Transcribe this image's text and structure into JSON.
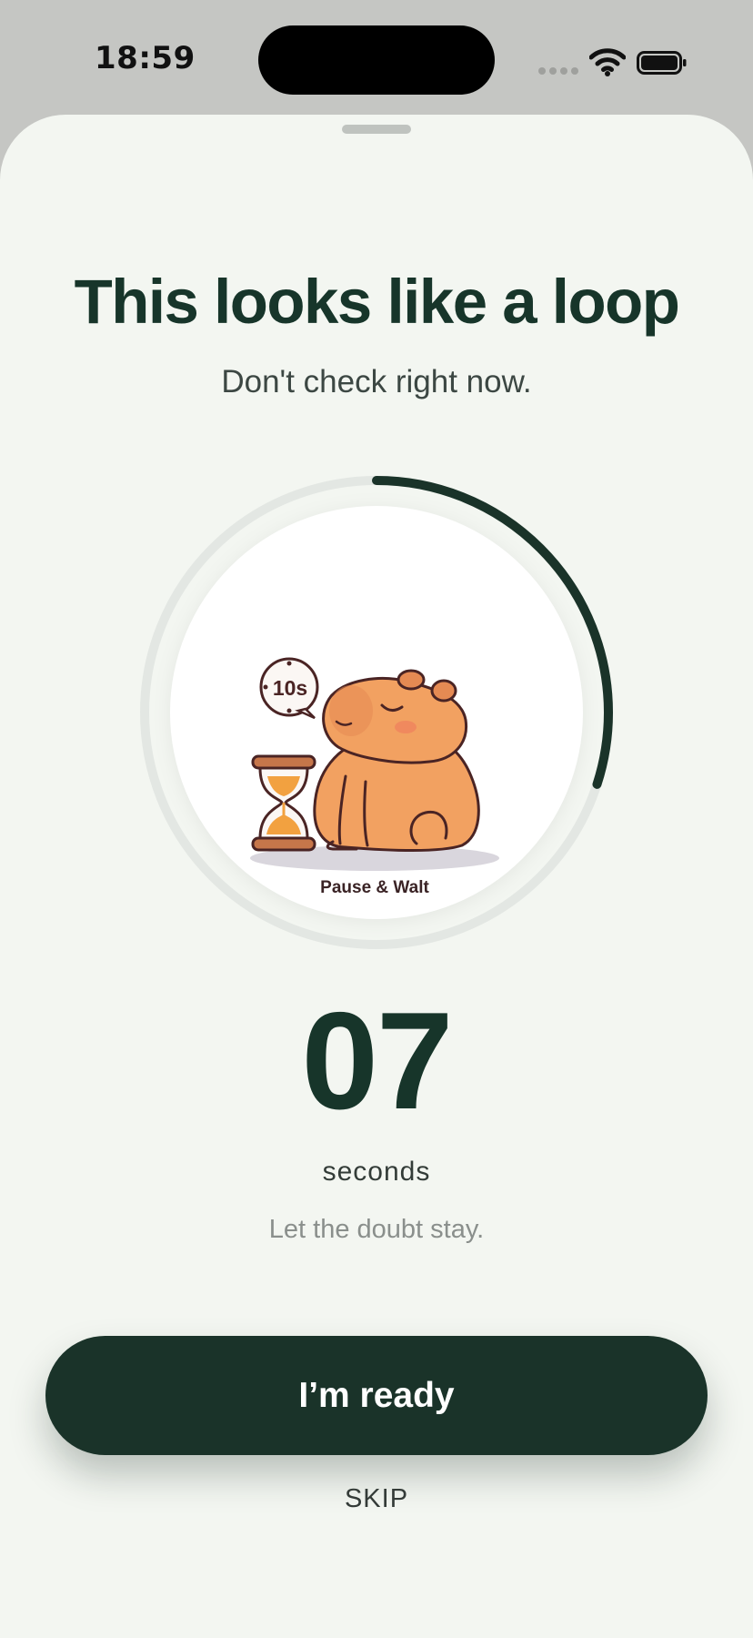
{
  "status_bar": {
    "time": "18:59",
    "icons": [
      "cellular-signal-icon",
      "wifi-icon",
      "battery-icon"
    ]
  },
  "sheet": {
    "title": "This looks like a loop",
    "subtitle": "Don't check right now."
  },
  "timer": {
    "progress": 0.3,
    "seconds_display": "07",
    "unit_label": "seconds",
    "hint": "Let the doubt stay."
  },
  "illustration": {
    "badge_text": "10s",
    "caption": "Pause & Walt"
  },
  "actions": {
    "ready_label": "I’m ready",
    "skip_label": "SKIP"
  },
  "colors": {
    "accent": "#1a3329",
    "sheet_background": "#f3f6f1",
    "ring_track": "#e3e7e3",
    "capybara": "#f2a161"
  }
}
